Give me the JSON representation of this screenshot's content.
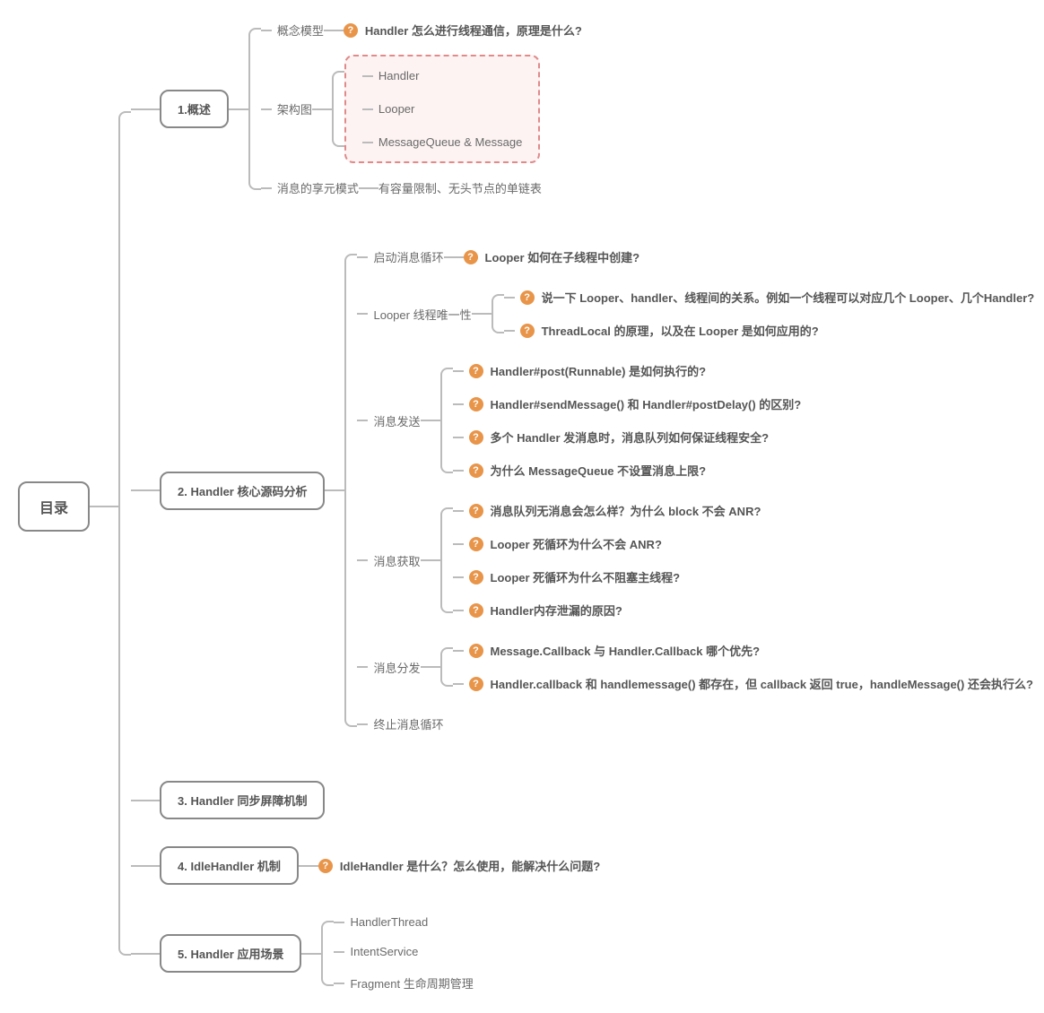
{
  "root": "目录",
  "s1": {
    "title": "1.概述",
    "c1": {
      "label": "概念模型",
      "q": "Handler 怎么进行线程通信，原理是什么?"
    },
    "c2": {
      "label": "架构图",
      "items": [
        "Handler",
        "Looper",
        "MessageQueue & Message"
      ]
    },
    "c3": {
      "label": "消息的享元模式",
      "note": "有容量限制、无头节点的单链表"
    }
  },
  "s2": {
    "title": "2. Handler 核心源码分析",
    "c1": {
      "label": "启动消息循环",
      "q": "Looper 如何在子线程中创建?"
    },
    "c2": {
      "label": "Looper 线程唯一性",
      "q1": "说一下 Looper、handler、线程间的关系。例如一个线程可以对应几个 Looper、几个Handler?",
      "q2": "ThreadLocal 的原理，以及在 Looper 是如何应用的?"
    },
    "c3": {
      "label": "消息发送",
      "q1": "Handler#post(Runnable) 是如何执行的?",
      "q2": "Handler#sendMessage() 和 Handler#postDelay() 的区别?",
      "q3": "多个 Handler 发消息时，消息队列如何保证线程安全?",
      "q4": "为什么 MessageQueue 不设置消息上限?"
    },
    "c4": {
      "label": "消息获取",
      "q1": "消息队列无消息会怎么样？为什么 block 不会 ANR?",
      "q2": "Looper 死循环为什么不会 ANR?",
      "q3": "Looper 死循环为什么不阻塞主线程?",
      "q4": "Handler内存泄漏的原因?"
    },
    "c5": {
      "label": "消息分发",
      "q1": "Message.Callback 与 Handler.Callback 哪个优先?",
      "q2": "Handler.callback 和 handlemessage() 都存在，但 callback 返回 true，handleMessage() 还会执行么?"
    },
    "c6": {
      "label": "终止消息循环"
    }
  },
  "s3": {
    "title": "3. Handler 同步屏障机制"
  },
  "s4": {
    "title": "4. IdleHandler 机制",
    "q": "IdleHandler 是什么？怎么使用，能解决什么问题?"
  },
  "s5": {
    "title": "5. Handler 应用场景",
    "items": [
      "HandlerThread",
      "IntentService",
      "Fragment 生命周期管理"
    ]
  }
}
